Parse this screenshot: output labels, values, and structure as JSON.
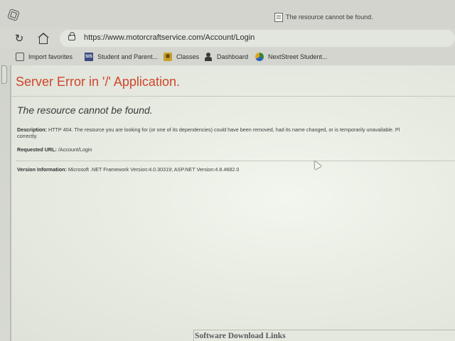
{
  "browser": {
    "tab_title": "The resource cannot be found.",
    "url": "https://www.motorcraftservice.com/Account/Login"
  },
  "favorites": [
    {
      "label": "Import favorites",
      "icon": "import-icon"
    },
    {
      "label": "Student and Parent...",
      "icon": "sis-icon"
    },
    {
      "label": "Classes",
      "icon": "classes-icon"
    },
    {
      "label": "Dashboard",
      "icon": "dashboard-icon"
    },
    {
      "label": "NextStreet Student...",
      "icon": "nextstreet-icon"
    }
  ],
  "error": {
    "title": "Server Error in '/' Application.",
    "subtitle": "The resource cannot be found.",
    "description_label": "Description:",
    "description_text": "HTTP 404. The resource you are looking for (or one of its dependencies) could have been removed, had its name changed, or is temporarily unavailable.  Pl",
    "description_cont": "correctly.",
    "requested_url_label": "Requested URL:",
    "requested_url_value": "/Account/Login",
    "version_label": "Version Information:",
    "version_value": "Microsoft .NET Framework Version:4.0.30319; ASP.NET Version:4.8.4682.0"
  },
  "footer": {
    "download_links_title": "Software Download Links"
  },
  "colors": {
    "error_title": "#d0452c",
    "page_background": "#eef1e9"
  }
}
